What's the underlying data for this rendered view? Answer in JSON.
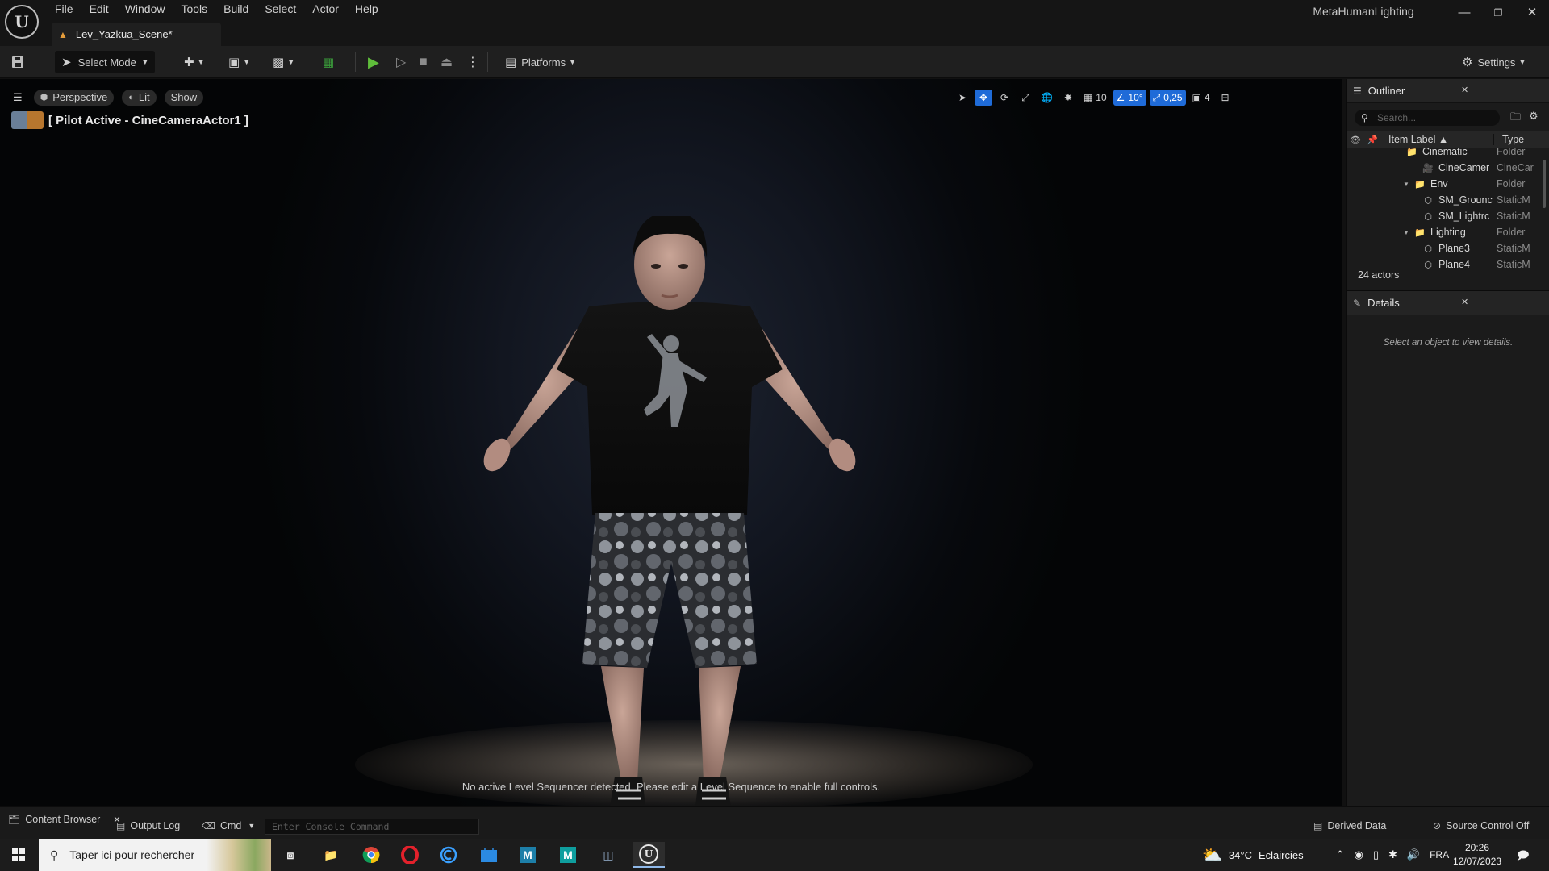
{
  "menu": [
    "File",
    "Edit",
    "Window",
    "Tools",
    "Build",
    "Select",
    "Actor",
    "Help"
  ],
  "level_tab": {
    "label": "Lev_Yazkua_Scene*"
  },
  "project_name": "MetaHumanLighting",
  "window_controls": {
    "minimize": "—",
    "restore": "❐",
    "close": "✕"
  },
  "toolbar": {
    "select_mode": "Select Mode",
    "platforms": "Platforms",
    "settings": "Settings"
  },
  "viewport": {
    "perspective": "Perspective",
    "lit": "Lit",
    "show": "Show",
    "pilot_label": "[ Pilot Active - CineCameraActor1 ]",
    "grid_snap": "10",
    "rotation_snap": "10°",
    "scale_snap": "0,25",
    "camera_speed": "4",
    "sequencer_message": "No active Level Sequencer detected. Please edit a Level Sequence to enable full controls."
  },
  "outliner": {
    "title": "Outliner",
    "search_placeholder": "Search...",
    "col_label": "Item Label ▲",
    "col_type": "Type",
    "rows": [
      {
        "label": "Cinematic",
        "type": "Folder",
        "kind": "folder",
        "indent": 1
      },
      {
        "label": "CineCamer",
        "type": "CineCar",
        "kind": "camera",
        "indent": 2
      },
      {
        "label": "Env",
        "type": "Folder",
        "kind": "folder",
        "indent": 1
      },
      {
        "label": "SM_Grounc",
        "type": "StaticM",
        "kind": "mesh",
        "indent": 2
      },
      {
        "label": "SM_Lightrc",
        "type": "StaticM",
        "kind": "mesh",
        "indent": 2
      },
      {
        "label": "Lighting",
        "type": "Folder",
        "kind": "folder",
        "indent": 1
      },
      {
        "label": "Plane3",
        "type": "StaticM",
        "kind": "mesh",
        "indent": 2
      },
      {
        "label": "Plane4",
        "type": "StaticM",
        "kind": "mesh",
        "indent": 2
      }
    ],
    "actor_count": "24 actors"
  },
  "details": {
    "title": "Details",
    "empty_message": "Select an object to view details."
  },
  "statusbar": {
    "content_browser": "Content Browser",
    "output_log": "Output Log",
    "cmd": "Cmd",
    "console_placeholder": "Enter Console Command",
    "derived_data": "Derived Data",
    "source_control": "Source Control Off"
  },
  "taskbar": {
    "search_placeholder": "Taper ici pour rechercher",
    "weather_temp": "34°C",
    "weather_text": "Eclaircies",
    "language": "FRA",
    "time": "20:26",
    "date": "12/07/2023"
  },
  "colors": {
    "play_green": "#5fbd3b",
    "accent_blue": "#1f6bd8",
    "folder_yellow": "#c9a35a"
  }
}
